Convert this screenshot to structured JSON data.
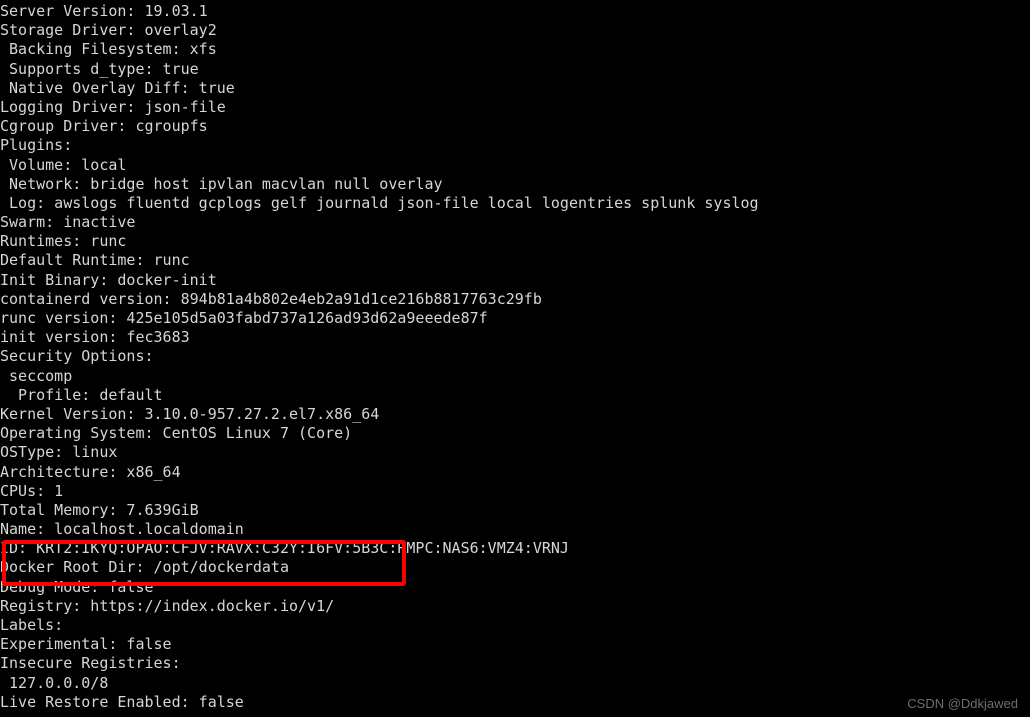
{
  "terminal": {
    "background_color": "#000000",
    "text_color": "#d6d6d6",
    "lines": [
      "Server Version: 19.03.1",
      "Storage Driver: overlay2",
      " Backing Filesystem: xfs",
      " Supports d_type: true",
      " Native Overlay Diff: true",
      "Logging Driver: json-file",
      "Cgroup Driver: cgroupfs",
      "Plugins:",
      " Volume: local",
      " Network: bridge host ipvlan macvlan null overlay",
      " Log: awslogs fluentd gcplogs gelf journald json-file local logentries splunk syslog",
      "Swarm: inactive",
      "Runtimes: runc",
      "Default Runtime: runc",
      "Init Binary: docker-init",
      "containerd version: 894b81a4b802e4eb2a91d1ce216b8817763c29fb",
      "runc version: 425e105d5a03fabd737a126ad93d62a9eeede87f",
      "init version: fec3683",
      "Security Options:",
      " seccomp",
      "  Profile: default",
      "Kernel Version: 3.10.0-957.27.2.el7.x86_64",
      "Operating System: CentOS Linux 7 (Core)",
      "OSType: linux",
      "Architecture: x86_64",
      "CPUs: 1",
      "Total Memory: 7.639GiB",
      "Name: localhost.localdomain",
      "ID: KRT2:IKYQ:OPAO:CFJV:RAVX:C32Y:I6FV:5B3C:RMPC:NAS6:VMZ4:VRNJ",
      "Docker Root Dir: /opt/dockerdata",
      "Debug Mode: false",
      "Registry: https://index.docker.io/v1/",
      "Labels:",
      "Experimental: false",
      "Insecure Registries:",
      " 127.0.0.0/8",
      "Live Restore Enabled: false"
    ]
  },
  "annotation": {
    "color": "#fe0000",
    "shape": "rectangle",
    "highlights": [
      "ID: KRT2:IKYQ:OPAO:CFJV:RAVX:C32Y:I6FV:5B3C:RMPC:NAS6:VMZ4:VRNJ",
      "Docker Root Dir: /opt/dockerdata",
      "Debug Mode: false"
    ]
  },
  "watermark": {
    "text": "CSDN @Ddkjawed",
    "color": "#6e6e6e"
  }
}
